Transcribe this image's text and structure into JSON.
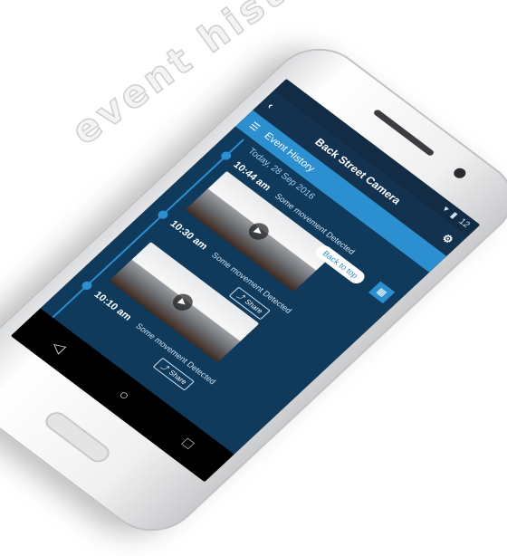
{
  "headline": "event history",
  "status": {
    "time": "12"
  },
  "topbar": {
    "title": "Back Street Camera",
    "back_icon": "back-icon",
    "settings_icon": "gear-icon"
  },
  "appbar": {
    "menu_icon": "menu-icon",
    "title": "Event History"
  },
  "timeline": {
    "date_label": "Today, 28 Sep 2016",
    "events": [
      {
        "time": "10:44 am",
        "message": "Some movement Detected"
      },
      {
        "time": "10:30 am",
        "message": "Some movement Detected"
      },
      {
        "time": "10:10 am",
        "message": "Some movement Detected"
      }
    ]
  },
  "share_label": "Share",
  "back_to_top_label": "Back to top",
  "colors": {
    "accent": "#2c8fd0",
    "panel": "#0f3a5c"
  }
}
